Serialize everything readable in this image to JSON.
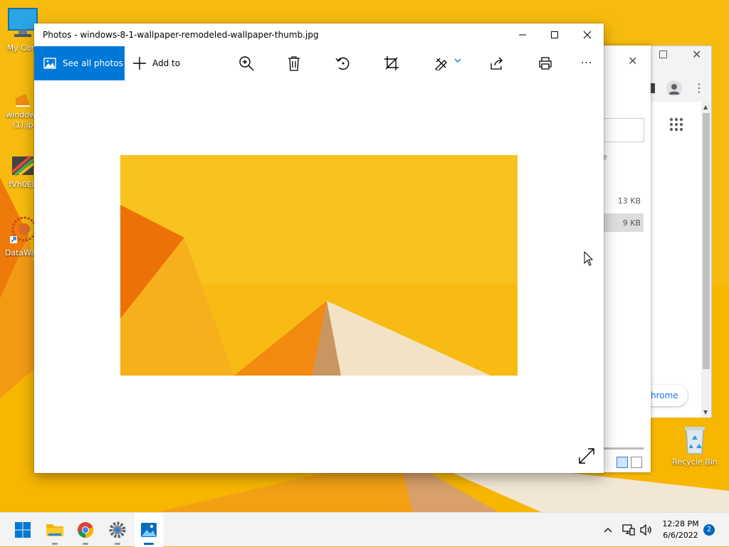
{
  "desktop": {
    "icons": [
      {
        "label": "My Com"
      },
      {
        "label": "windows"
      },
      {
        "label": "(1).jp"
      },
      {
        "label": "fVh0EI,"
      },
      {
        "label": "DataWag"
      }
    ],
    "recycle_bin": {
      "label": "Recycle Bin"
    }
  },
  "explorer_bg": {
    "peek_text": "e",
    "sizes": [
      "13 KB",
      "9 KB"
    ]
  },
  "chrome_bg": {
    "pill_text": "hrome"
  },
  "photos": {
    "title": "Photos - windows-8-1-wallpaper-remodeled-wallpaper-thumb.jpg",
    "see_all_label": "See all photos",
    "add_to_label": "Add to",
    "tools": [
      "zoom-in-icon",
      "delete-icon",
      "rotate-icon",
      "crop-icon",
      "edit-icon",
      "share-icon",
      "print-icon",
      "more-icon"
    ],
    "more_label": "···"
  },
  "taskbar": {
    "apps": [
      "start",
      "file-explorer",
      "chrome",
      "settings",
      "photos"
    ],
    "time": "12:28 PM",
    "date": "6/6/2022",
    "notification_count": "2"
  },
  "colors": {
    "accent": "#0078d7",
    "wallpaper": "#f5b800",
    "taskbar_accent": "#0067c0"
  }
}
